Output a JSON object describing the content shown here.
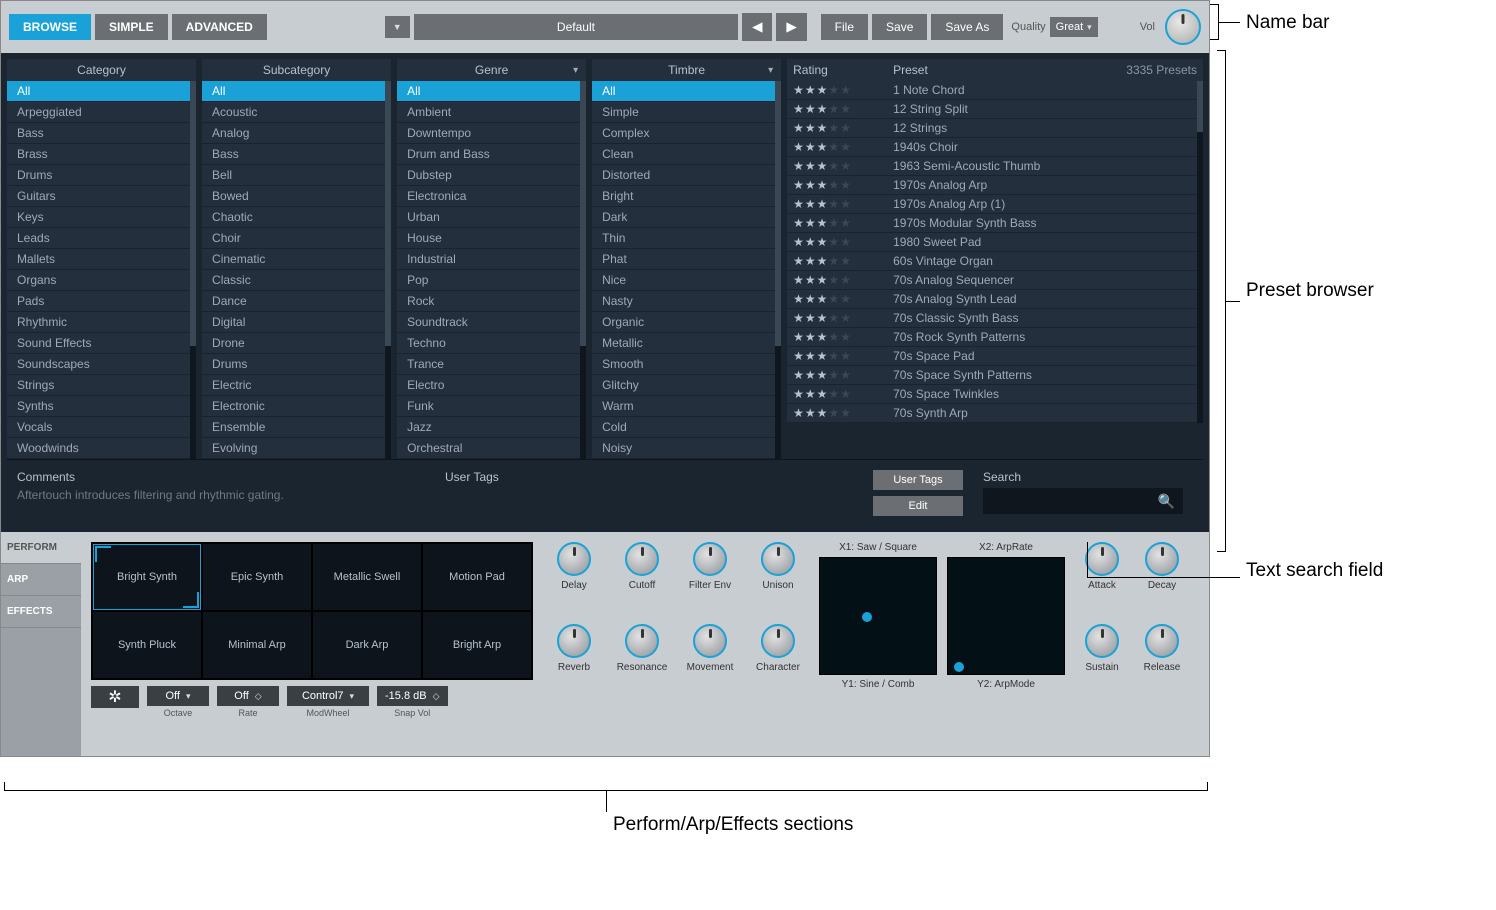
{
  "namebar": {
    "tabs": [
      "BROWSE",
      "SIMPLE",
      "ADVANCED"
    ],
    "preset_name": "Default",
    "file": "File",
    "save": "Save",
    "save_as": "Save As",
    "quality_label": "Quality",
    "quality_value": "Great",
    "vol_label": "Vol"
  },
  "browser": {
    "columns": {
      "category": {
        "title": "Category",
        "items": [
          "All",
          "Arpeggiated",
          "Bass",
          "Brass",
          "Drums",
          "Guitars",
          "Keys",
          "Leads",
          "Mallets",
          "Organs",
          "Pads",
          "Rhythmic",
          "Sound Effects",
          "Soundscapes",
          "Strings",
          "Synths",
          "Vocals",
          "Woodwinds"
        ]
      },
      "subcategory": {
        "title": "Subcategory",
        "items": [
          "All",
          "Acoustic",
          "Analog",
          "Bass",
          "Bell",
          "Bowed",
          "Chaotic",
          "Choir",
          "Cinematic",
          "Classic",
          "Dance",
          "Digital",
          "Drone",
          "Drums",
          "Electric",
          "Electronic",
          "Ensemble",
          "Evolving"
        ]
      },
      "genre": {
        "title": "Genre",
        "items": [
          "All",
          "Ambient",
          "Downtempo",
          "Drum and Bass",
          "Dubstep",
          "Electronica",
          "Urban",
          "House",
          "Industrial",
          "Pop",
          "Rock",
          "Soundtrack",
          "Techno",
          "Trance",
          "Electro",
          "Funk",
          "Jazz",
          "Orchestral"
        ]
      },
      "timbre": {
        "title": "Timbre",
        "items": [
          "All",
          "Simple",
          "Complex",
          "Clean",
          "Distorted",
          "Bright",
          "Dark",
          "Thin",
          "Phat",
          "Nice",
          "Nasty",
          "Organic",
          "Metallic",
          "Smooth",
          "Glitchy",
          "Warm",
          "Cold",
          "Noisy"
        ]
      }
    },
    "preset_header": {
      "rating": "Rating",
      "preset": "Preset",
      "count": "3335 Presets"
    },
    "presets": [
      {
        "rating": 3,
        "name": "1 Note Chord"
      },
      {
        "rating": 3,
        "name": "12 String Split"
      },
      {
        "rating": 3,
        "name": "12 Strings"
      },
      {
        "rating": 3,
        "name": "1940s Choir"
      },
      {
        "rating": 3,
        "name": "1963 Semi-Acoustic Thumb"
      },
      {
        "rating": 3,
        "name": "1970s Analog Arp"
      },
      {
        "rating": 3,
        "name": "1970s Analog Arp (1)"
      },
      {
        "rating": 3,
        "name": "1970s Modular Synth Bass"
      },
      {
        "rating": 3,
        "name": "1980 Sweet Pad"
      },
      {
        "rating": 3,
        "name": "60s Vintage Organ"
      },
      {
        "rating": 3,
        "name": "70s Analog Sequencer"
      },
      {
        "rating": 3,
        "name": "70s Analog Synth Lead"
      },
      {
        "rating": 3,
        "name": "70s Classic Synth Bass"
      },
      {
        "rating": 3,
        "name": "70s Rock Synth Patterns"
      },
      {
        "rating": 3,
        "name": "70s Space Pad"
      },
      {
        "rating": 3,
        "name": "70s Space Synth Patterns"
      },
      {
        "rating": 3,
        "name": "70s Space Twinkles"
      },
      {
        "rating": 3,
        "name": "70s Synth Arp"
      }
    ],
    "comments_label": "Comments",
    "comments_text": "Aftertouch introduces filtering and rhythmic gating.",
    "user_tags_label": "User Tags",
    "user_tags_btn": "User Tags",
    "edit_btn": "Edit",
    "search_label": "Search"
  },
  "perform": {
    "side_tabs": [
      "PERFORM",
      "ARP",
      "EFFECTS"
    ],
    "pads": [
      "Bright Synth",
      "Epic Synth",
      "Metallic Swell",
      "Motion Pad",
      "Synth Pluck",
      "Minimal Arp",
      "Dark Arp",
      "Bright Arp"
    ],
    "pad_controls": {
      "octave": {
        "label": "Octave",
        "value": "Off"
      },
      "rate": {
        "label": "Rate",
        "value": "Off"
      },
      "modwheel": {
        "label": "ModWheel",
        "value": "Control7"
      },
      "snapvol": {
        "label": "Snap Vol",
        "value": "-15.8 dB"
      }
    },
    "knobs_top": [
      "Delay",
      "Cutoff",
      "Filter Env",
      "Unison"
    ],
    "knobs_bot": [
      "Reverb",
      "Resonance",
      "Movement",
      "Character"
    ],
    "xy1": {
      "x": "X1: Saw / Square",
      "y": "Y1: Sine / Comb"
    },
    "xy2": {
      "x": "X2: ArpRate",
      "y": "Y2: ArpMode"
    },
    "adsr": [
      "Attack",
      "Decay",
      "Sustain",
      "Release"
    ]
  },
  "callouts": {
    "namebar": "Name bar",
    "preset_browser": "Preset browser",
    "search_field": "Text search field",
    "perform": "Perform/Arp/Effects sections"
  }
}
